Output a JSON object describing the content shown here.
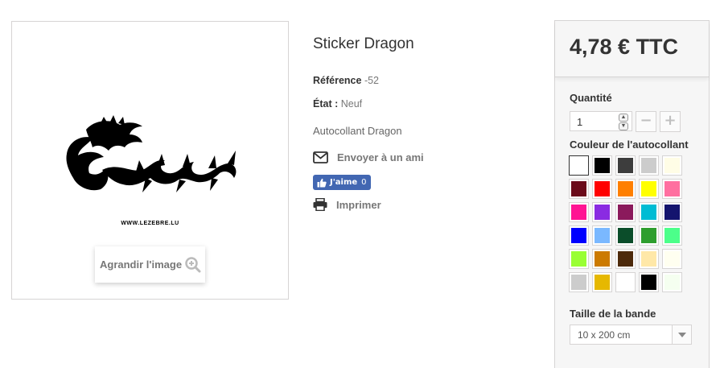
{
  "product": {
    "image_caption": "WWW.LEZEBRE.LU",
    "enlarge_label": "Agrandir l'image",
    "title": "Sticker Dragon",
    "reference_label": "Référence",
    "reference_value": "-52",
    "condition_label": "État :",
    "condition_value": "Neuf",
    "description": "Autocollant Dragon"
  },
  "actions": {
    "send_friend": "Envoyer à un ami",
    "like_label": "J'aime",
    "like_count": "0",
    "print": "Imprimer"
  },
  "buybox": {
    "price": "4,78 € TTC",
    "quantity_label": "Quantité",
    "quantity_value": "1",
    "color_label": "Couleur de l'autocollant",
    "band_label": "Taille de la bande",
    "band_selected": "10 x 200 cm"
  },
  "colors": [
    "#ffffff",
    "#000000",
    "#3d3d3d",
    "#cccccc",
    "#fffde6",
    "#6b0a1a",
    "#ff0000",
    "#ff7f00",
    "#ffff00",
    "#ff6fa0",
    "#ff1493",
    "#8a2be2",
    "#8b1a5c",
    "#00bcd4",
    "#14146e",
    "#0000ff",
    "#7ab8ff",
    "#0b4d2a",
    "#2e9e2e",
    "#4cff8a",
    "#99ff33",
    "#cc7a00",
    "#4d2a0b",
    "#ffe8a8",
    "#fffff0",
    "#cccccc",
    "#e6b800",
    "#ffffff",
    "#000000",
    "#f5fff0"
  ],
  "selected_color_index": 0
}
